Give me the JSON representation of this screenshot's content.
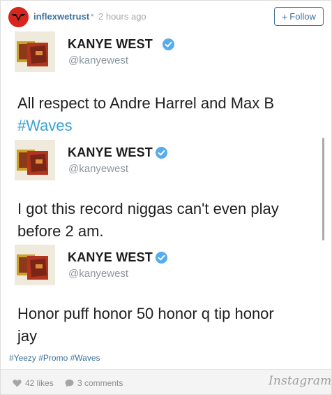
{
  "header": {
    "username": "inflexwetrust",
    "separator": "•",
    "time": "2 hours ago",
    "follow_plus": "+",
    "follow_label": "Follow"
  },
  "tweets": [
    {
      "name": "KANYE WEST",
      "handle": "@kanyewest",
      "text": "All respect to Andre Harrel and Max B",
      "hashtag": "#Waves"
    },
    {
      "name": "KANYE WEST",
      "handle": "@kanyewest",
      "text_line1": "I got this record niggas can't even play",
      "text_line2": "before 2 am."
    },
    {
      "name": "KANYE WEST",
      "handle": "@kanyewest",
      "text_line1": "Honor puff honor 50 honor q tip honor",
      "text_line2": "jay"
    }
  ],
  "caption": "#Yeezy #Promo #Waves",
  "footer": {
    "likes": "42 likes",
    "comments": "3 comments",
    "logo": "Instagram"
  },
  "colors": {
    "link_blue": "#3f729b",
    "twitter_blue": "#3aa2d6",
    "avatar_red": "#d9261c"
  },
  "icons": [
    "inflexwetrust-logo-icon",
    "verified-badge-icon",
    "heart-icon",
    "comment-bubble-icon"
  ]
}
